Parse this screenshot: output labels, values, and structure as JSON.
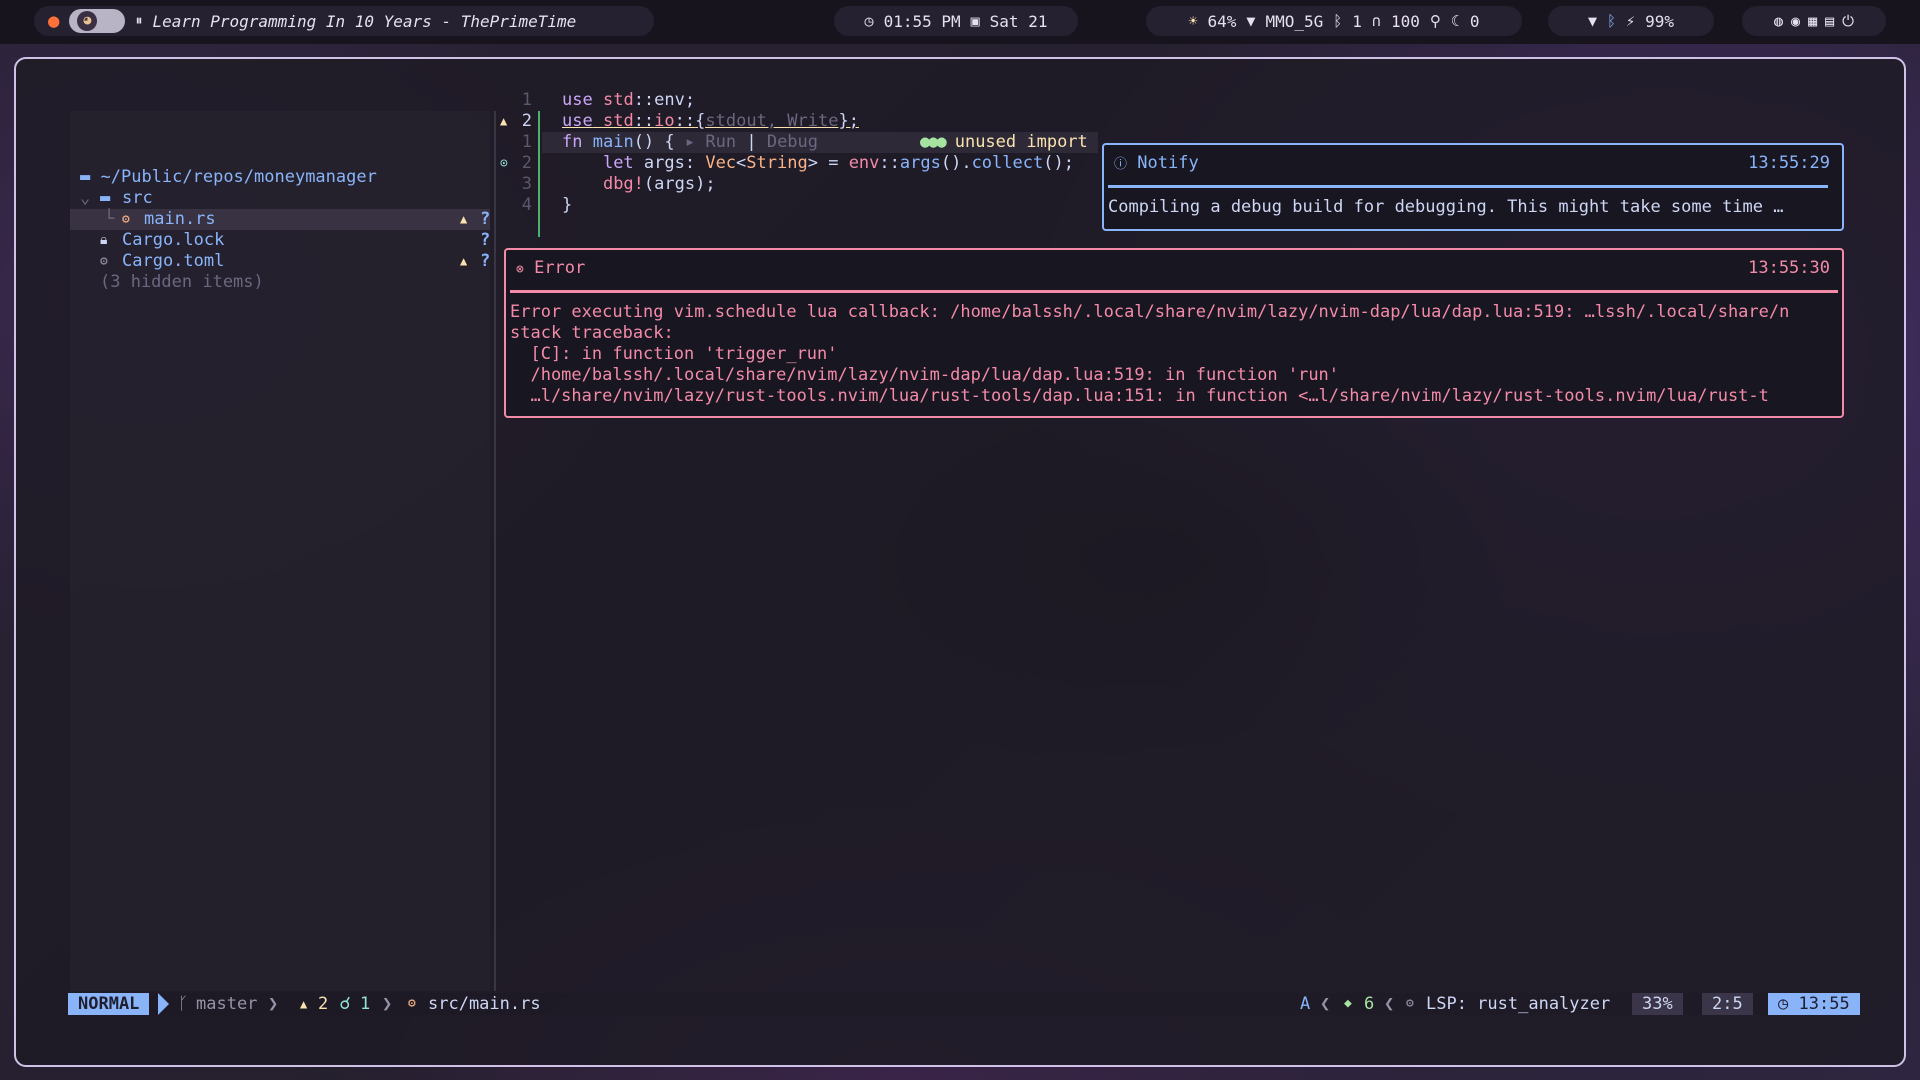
{
  "topbar": {
    "media": {
      "pause_icon": "⏸",
      "title": "Learn Programming In 10 Years - ThePrimeTime"
    },
    "clock": {
      "time": "01:55 PM",
      "date": "Sat 21"
    },
    "system": {
      "brightness": "64%",
      "wifi_ssid": "MMO_5G",
      "bluetooth": "1",
      "volume": "100",
      "mic": "",
      "dnd": "0"
    },
    "battery": "99%"
  },
  "tree": {
    "root": "~/Public/repos/moneymanager",
    "items": [
      {
        "label": "src",
        "kind": "folder"
      },
      {
        "label": "main.rs",
        "kind": "file"
      },
      {
        "label": "Cargo.lock",
        "kind": "file"
      },
      {
        "label": "Cargo.toml",
        "kind": "file"
      }
    ],
    "hidden": "(3 hidden items)",
    "warn_mark": "▲",
    "q_mark": "?"
  },
  "editor": {
    "line_numbers": [
      "1",
      "2",
      "1",
      "2",
      "3",
      "4"
    ],
    "lines": {
      "l1_kw": "use",
      "l1_ns": "std",
      "l1_rest": "::env;",
      "l2_kw": "use",
      "l2_ns": "std",
      "l2_mid": "::",
      "l2_ns2": "io",
      "l2_sep": "::",
      "l2_brace": "{",
      "l2_items": "stdout, Write",
      "l2_end": "};",
      "l3_kw": "fn",
      "l3_fn": "main",
      "l3_rest": "() {",
      "run": "▸ Run",
      "sep": "|",
      "debug": "Debug",
      "l4_kw": "let",
      "l4_var": " args: ",
      "l4_ty": "Vec",
      "l4_lt": "<",
      "l4_ty2": "String",
      "l4_gt": ">",
      "l4_eq": " = ",
      "l4_ns": "env",
      "l4_sep": "::",
      "l4_fn": "args",
      "l4_p": "().",
      "l4_fn2": "collect",
      "l4_end": "();",
      "l5_mac": "dbg!",
      "l5_rest": "(args);",
      "l6": "}"
    },
    "virtual_text": {
      "dots": "●●●",
      "message": "unused import"
    }
  },
  "notify": {
    "title": "Notify",
    "time": "13:55:29",
    "message": "Compiling a debug build for debugging. This might take some time …"
  },
  "error": {
    "title": "Error",
    "time": "13:55:30",
    "lines": [
      "Error executing vim.schedule lua callback: /home/balssh/.local/share/nvim/lazy/nvim-dap/lua/dap.lua:519: …lssh/.local/share/n",
      "stack traceback:",
      "  [C]: in function 'trigger_run'",
      "  /home/balssh/.local/share/nvim/lazy/nvim-dap/lua/dap.lua:519: in function 'run'",
      "  …l/share/nvim/lazy/rust-tools.nvim/lua/rust-tools/dap.lua:151: in function <…l/share/nvim/lazy/rust-tools.nvim/lua/rust-t"
    ]
  },
  "statusline": {
    "mode": "NORMAL",
    "branch": "master",
    "warnings": "2",
    "hints": "1",
    "file": "src/main.rs",
    "encoding_flag": "A",
    "lsp_count": "6",
    "lsp": "LSP: rust_analyzer",
    "percent": "33%",
    "position": "2:5",
    "clock": "13:55"
  }
}
